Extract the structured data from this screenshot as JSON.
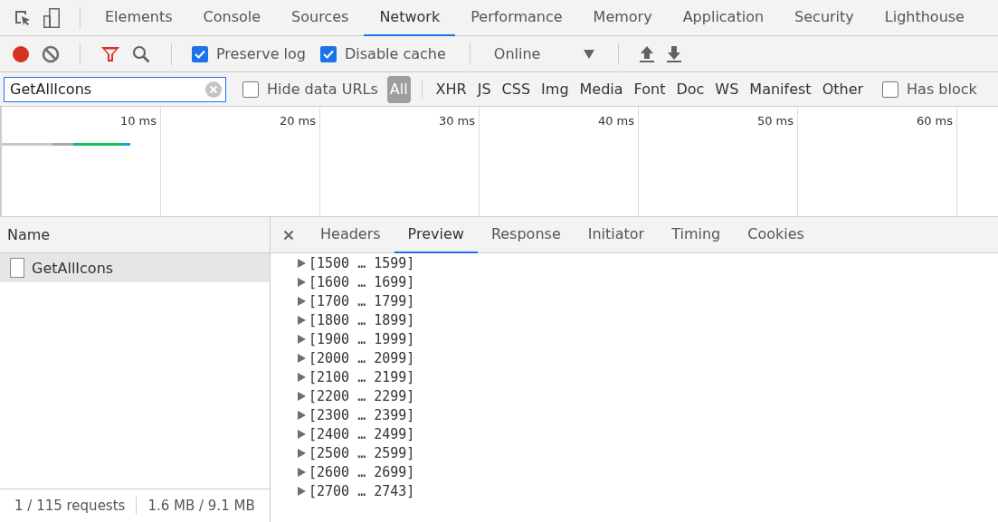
{
  "tabs": [
    {
      "label": "Elements",
      "selected": false
    },
    {
      "label": "Console",
      "selected": false
    },
    {
      "label": "Sources",
      "selected": false
    },
    {
      "label": "Network",
      "selected": true
    },
    {
      "label": "Performance",
      "selected": false
    },
    {
      "label": "Memory",
      "selected": false
    },
    {
      "label": "Application",
      "selected": false
    },
    {
      "label": "Security",
      "selected": false
    },
    {
      "label": "Lighthouse",
      "selected": false
    }
  ],
  "toolbar": {
    "recording": true,
    "preserve_log": {
      "label": "Preserve log",
      "checked": true
    },
    "disable_cache": {
      "label": "Disable cache",
      "checked": true
    },
    "throttling": "Online"
  },
  "filter": {
    "value": "GetAllIcons",
    "hide_data_urls": {
      "label": "Hide data URLs",
      "checked": false
    },
    "types": [
      {
        "label": "All",
        "selected": true
      },
      {
        "label": "XHR",
        "selected": false
      },
      {
        "label": "JS",
        "selected": false
      },
      {
        "label": "CSS",
        "selected": false
      },
      {
        "label": "Img",
        "selected": false
      },
      {
        "label": "Media",
        "selected": false
      },
      {
        "label": "Font",
        "selected": false
      },
      {
        "label": "Doc",
        "selected": false
      },
      {
        "label": "WS",
        "selected": false
      },
      {
        "label": "Manifest",
        "selected": false
      },
      {
        "label": "Other",
        "selected": false
      }
    ],
    "has_blocked": {
      "label": "Has block",
      "checked": false
    }
  },
  "overview": {
    "ticks": [
      "10 ms",
      "20 ms",
      "30 ms",
      "40 ms",
      "50 ms",
      "60 ms"
    ]
  },
  "requests": {
    "column": "Name",
    "rows": [
      {
        "name": "GetAllIcons",
        "selected": true
      }
    ]
  },
  "detail_tabs": [
    {
      "label": "Headers",
      "selected": false
    },
    {
      "label": "Preview",
      "selected": true
    },
    {
      "label": "Response",
      "selected": false
    },
    {
      "label": "Initiator",
      "selected": false
    },
    {
      "label": "Timing",
      "selected": false
    },
    {
      "label": "Cookies",
      "selected": false
    }
  ],
  "preview": [
    "[1500 … 1599]",
    "[1600 … 1699]",
    "[1700 … 1799]",
    "[1800 … 1899]",
    "[1900 … 1999]",
    "[2000 … 2099]",
    "[2100 … 2199]",
    "[2200 … 2299]",
    "[2300 … 2399]",
    "[2400 … 2499]",
    "[2500 … 2599]",
    "[2600 … 2699]",
    "[2700 … 2743]"
  ],
  "status_bar": {
    "requests": "1 / 115 requests",
    "transferred": "1.6 MB / 9.1 MB"
  }
}
